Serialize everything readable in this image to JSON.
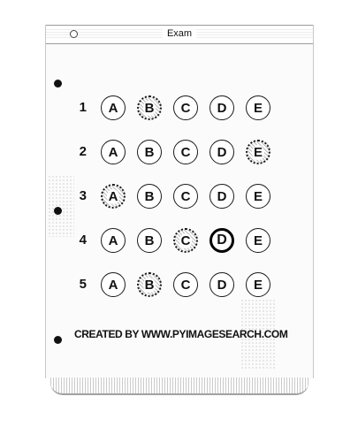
{
  "window": {
    "title": "Exam"
  },
  "sheet": {
    "questions": [
      {
        "number": "1",
        "options": [
          "A",
          "B",
          "C",
          "D",
          "E"
        ],
        "shaded": [
          "B"
        ],
        "marked": []
      },
      {
        "number": "2",
        "options": [
          "A",
          "B",
          "C",
          "D",
          "E"
        ],
        "shaded": [
          "E"
        ],
        "marked": []
      },
      {
        "number": "3",
        "options": [
          "A",
          "B",
          "C",
          "D",
          "E"
        ],
        "shaded": [
          "A"
        ],
        "marked": []
      },
      {
        "number": "4",
        "options": [
          "A",
          "B",
          "C",
          "D",
          "E"
        ],
        "shaded": [
          "C"
        ],
        "marked": [
          "D"
        ]
      },
      {
        "number": "5",
        "options": [
          "A",
          "B",
          "C",
          "D",
          "E"
        ],
        "shaded": [
          "B"
        ],
        "marked": []
      }
    ],
    "credit": "CREATED BY WWW.PYIMAGESEARCH.COM"
  }
}
